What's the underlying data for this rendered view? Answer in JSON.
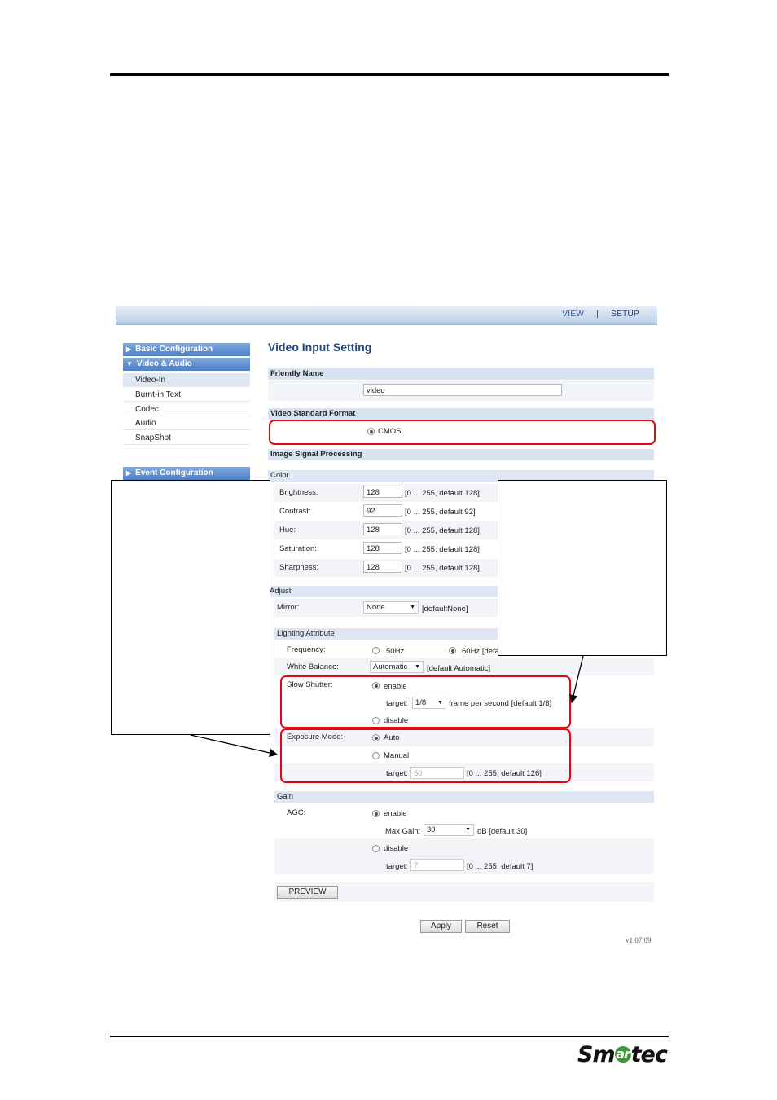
{
  "header": {
    "nav_view": "VIEW",
    "nav_sep": "|",
    "nav_setup": "SETUP"
  },
  "sidebar": {
    "basic": "Basic Configuration",
    "video_audio": "Video & Audio",
    "items": [
      "Video-In",
      "Burnt-in Text",
      "Codec",
      "Audio",
      "SnapShot"
    ],
    "event": "Event Configuration"
  },
  "page": {
    "title": "Video Input Setting"
  },
  "friendly": {
    "header": "Friendly Name",
    "value": "video"
  },
  "standard": {
    "header": "Video Standard Format",
    "option": "CMOS"
  },
  "isp": {
    "header": "Image Signal Processing"
  },
  "color": {
    "header": "Color",
    "rows": [
      {
        "label": "Brightness:",
        "value": "128",
        "range": "[0 ... 255, default 128]"
      },
      {
        "label": "Contrast:",
        "value": "92",
        "range": "[0 ... 255, default  92]"
      },
      {
        "label": "Hue:",
        "value": "128",
        "range": "[0 ... 255, default 128]"
      },
      {
        "label": "Saturation:",
        "value": "128",
        "range": "[0 ... 255, default 128]"
      },
      {
        "label": "Sharpness:",
        "value": "128",
        "range": "[0 ... 255, default 128]"
      }
    ]
  },
  "adjust": {
    "header": "Adjust",
    "mirror_label": "Mirror:",
    "mirror_value": "None",
    "mirror_default": "[defaultNone]"
  },
  "lighting": {
    "header": "Lighting Attribute",
    "freq_label": "Frequency:",
    "freq_50": "50Hz",
    "freq_60": "60Hz [defa",
    "wb_label": "White Balance:",
    "wb_value": "Automatic",
    "wb_default": "[default  Automatic]",
    "ss_label": "Slow Shutter:",
    "ss_enable": "enable",
    "ss_target_label": "target:",
    "ss_target": "1/8",
    "ss_note": "frame per second [default 1/8]",
    "ss_disable": "disable",
    "exp_label": "Exposure Mode:",
    "exp_auto": "Auto",
    "exp_manual": "Manual",
    "exp_target_label": "target:",
    "exp_target": "50",
    "exp_range": "[0 ... 255, default 126]"
  },
  "gain": {
    "header": "Gain",
    "agc_label": "AGC:",
    "enable": "enable",
    "max_label": "Max Gain:",
    "max_value": "30",
    "max_note": "dB [default 30]",
    "disable": "disable",
    "target_label": "target:",
    "target_value": "7",
    "target_range": "[0 ... 255, default 7]"
  },
  "buttons": {
    "preview": "PREVIEW",
    "apply": "Apply",
    "reset": "Reset"
  },
  "version": "v1.07.09",
  "logo": {
    "pre": "Sm",
    "mid": "ar",
    "post": "tec"
  },
  "colors": {
    "accent": "#24467d",
    "annotation": "#e30613",
    "sidebar": "#4d80c8"
  }
}
